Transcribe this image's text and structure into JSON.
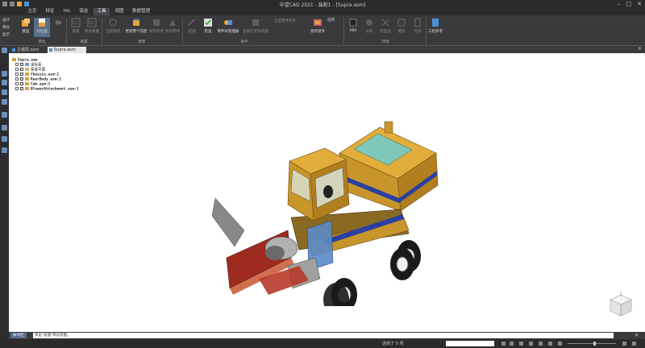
{
  "window": {
    "title": "中望CAD 2021 - 装配1 - [Supra.asm]"
  },
  "menu_tabs": [
    {
      "label": "主页"
    },
    {
      "label": "特征"
    },
    {
      "label": "HG"
    },
    {
      "label": "钣金"
    },
    {
      "label": "工具",
      "active": true
    },
    {
      "label": "视图"
    },
    {
      "label": "数据管理"
    }
  ],
  "ribbon": {
    "left_small": [
      "设计",
      "简化",
      "显示"
    ],
    "groups": {
      "jianhua": "简化",
      "zhongzhi": "重置",
      "gengxin": "更新",
      "zhushou": "助手",
      "kuangjia": "环境"
    },
    "buttons": {
      "model": "模型",
      "same_layer": "同位面",
      "empty1": "",
      "reset": "重置",
      "move_reset": "移动重置",
      "rebuild_all": "全部重建",
      "update_all": "更新整个装配",
      "update_features": "更新参考",
      "update_parts": "更新零件",
      "inspect": "检测",
      "check": "检查",
      "parts_manager": "零件树管理器",
      "history": "查看历史树管理",
      "multi_update": "更新组件",
      "lib": "XBA",
      "analyze": "分析",
      "edge": "检查边",
      "measure": "属性",
      "output": "检测",
      "pro_tool": "工程参考"
    },
    "small_items": {
      "all_parts": "全选零件参考",
      "options": "选项"
    }
  },
  "doc_tabs": [
    {
      "label": "主装配.asm",
      "active": false
    },
    {
      "label": "Supra.asm",
      "active": true
    }
  ],
  "tree": [
    {
      "label": "Supra.asm",
      "icon": "assembly-icon",
      "level": 0
    },
    {
      "label": "坐标系",
      "icon": "coordinate-icon",
      "level": 1
    },
    {
      "label": "基准平面",
      "icon": "plane-icon",
      "level": 1
    },
    {
      "label": "Chassis.asm:1",
      "icon": "assembly-icon",
      "level": 1
    },
    {
      "label": "RearBody.asm:1",
      "icon": "assembly-icon",
      "level": 1
    },
    {
      "label": "Cab.asm:1",
      "icon": "assembly-icon",
      "level": 1
    },
    {
      "label": "BlowerAttachment.asm:1",
      "icon": "assembly-icon",
      "level": 1
    }
  ],
  "command": {
    "label": "命令栏",
    "text": "单击\"处理\"简化装配。"
  },
  "status": {
    "selection": "选择了 0 项",
    "search_placeholder": ""
  },
  "colors": {
    "ribbon_bg": "#3a3a3d",
    "active_tab": "#4a4a4e",
    "selected": "#5a6e88",
    "truck_body": "#c8952a",
    "stripe": "#2a3fa0"
  }
}
